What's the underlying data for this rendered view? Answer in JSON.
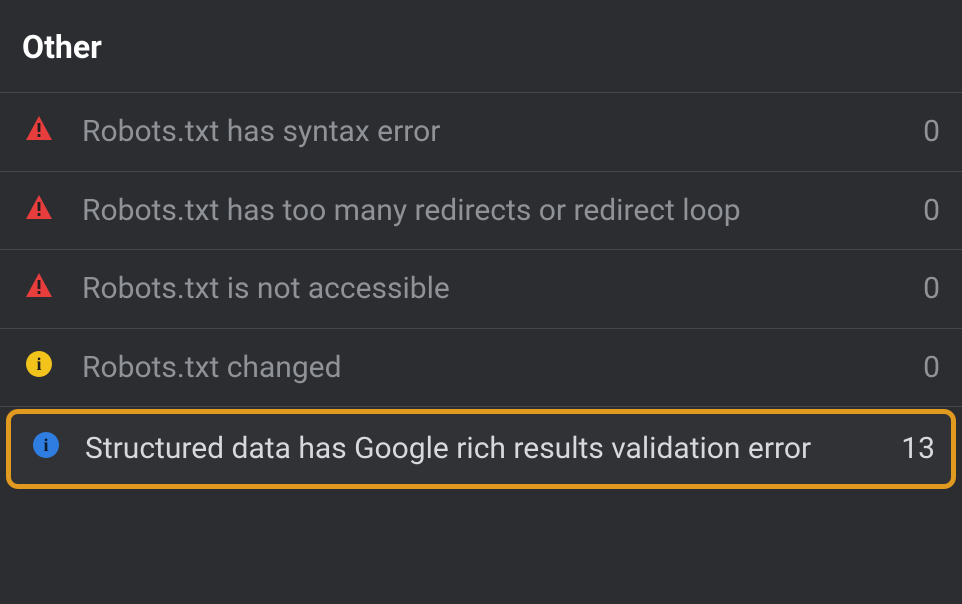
{
  "section": {
    "title": "Other"
  },
  "colors": {
    "error_icon": "#e83d3d",
    "warning_icon_bg": "#f2c31b",
    "info_icon_bg": "#2f7de1",
    "highlight_border": "#e09a1f"
  },
  "rows": [
    {
      "icon": "error-triangle",
      "label": "Robots.txt has syntax error",
      "count": "0",
      "highlighted": false
    },
    {
      "icon": "error-triangle",
      "label": "Robots.txt has too many redirects or redirect loop",
      "count": "0",
      "highlighted": false
    },
    {
      "icon": "error-triangle",
      "label": "Robots.txt is not accessible",
      "count": "0",
      "highlighted": false
    },
    {
      "icon": "warning-circle",
      "label": "Robots.txt changed",
      "count": "0",
      "highlighted": false
    },
    {
      "icon": "info-circle",
      "label": "Structured data has Google rich results validation error",
      "count": "13",
      "highlighted": true
    }
  ]
}
